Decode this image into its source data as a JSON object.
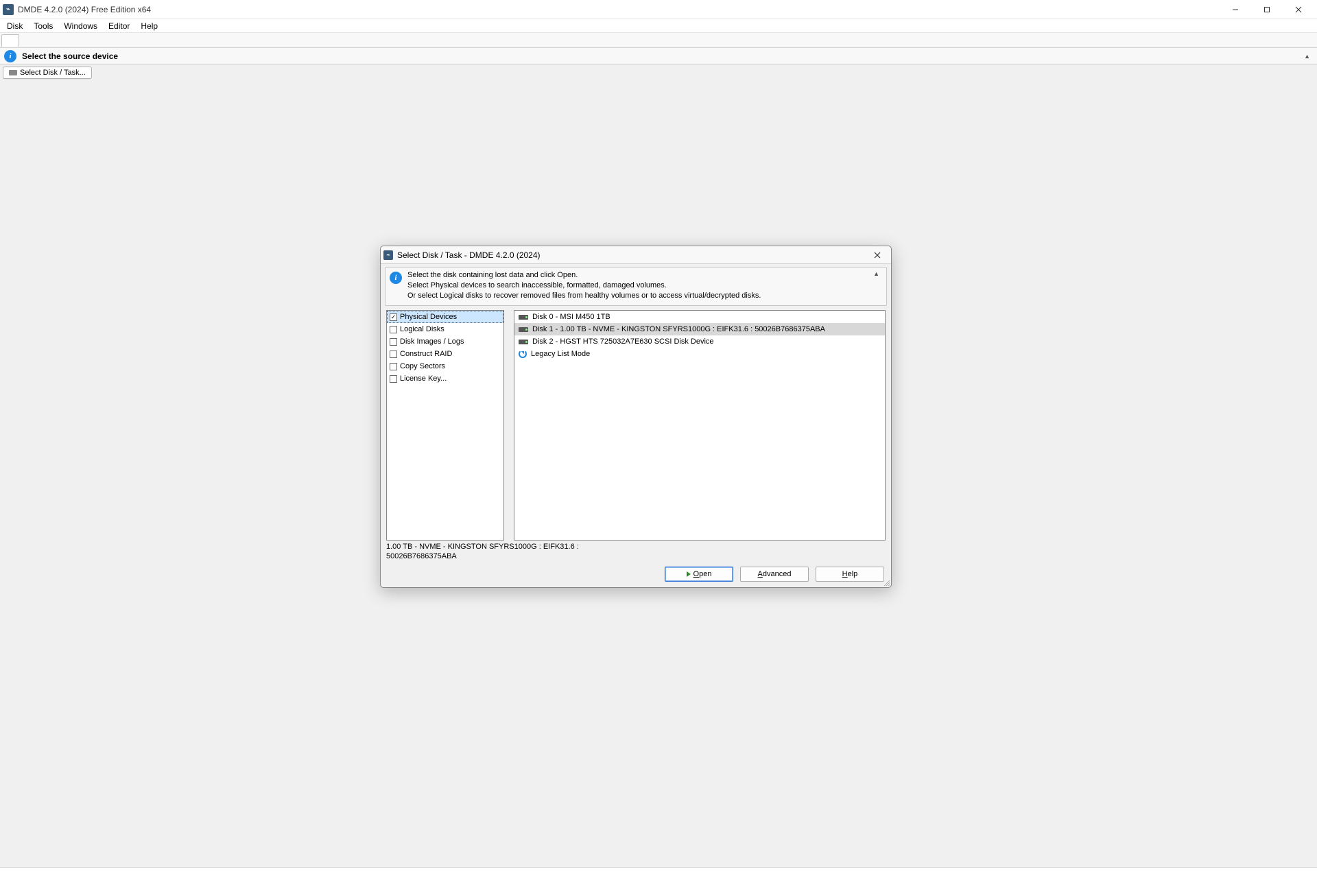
{
  "window": {
    "title": "DMDE 4.2.0 (2024) Free Edition x64"
  },
  "menu": {
    "items": [
      "Disk",
      "Tools",
      "Windows",
      "Editor",
      "Help"
    ]
  },
  "banner": {
    "text": "Select the source device"
  },
  "tab_button": {
    "label": "Select Disk / Task..."
  },
  "dialog": {
    "title": "Select Disk / Task - DMDE 4.2.0 (2024)",
    "info_line1": "Select the disk containing lost data and click Open.",
    "info_line2": "Select Physical devices to search inaccessible, formatted, damaged volumes.",
    "info_line3": "Or select Logical disks to recover removed files from healthy volumes or to access virtual/decrypted disks.",
    "tasks": [
      {
        "label": "Physical Devices",
        "checked": true,
        "selected": true
      },
      {
        "label": "Logical Disks",
        "checked": false,
        "selected": false
      },
      {
        "label": "Disk Images / Logs",
        "checked": false,
        "selected": false
      },
      {
        "label": "Construct RAID",
        "checked": false,
        "selected": false
      },
      {
        "label": "Copy Sectors",
        "checked": false,
        "selected": false
      },
      {
        "label": "License Key...",
        "checked": false,
        "selected": false
      }
    ],
    "devices": [
      {
        "label": "Disk 0 - MSI M450 1TB",
        "icon": "drive",
        "selected": false
      },
      {
        "label": "Disk 1 - 1.00 TB - NVME - KINGSTON SFYRS1000G : EIFK31.6 : 50026B7686375ABA",
        "icon": "drive",
        "selected": true
      },
      {
        "label": "Disk 2 - HGST HTS 725032A7E630 SCSI Disk Device",
        "icon": "drive",
        "selected": false
      },
      {
        "label": "Legacy List Mode",
        "icon": "refresh",
        "selected": false
      }
    ],
    "status_line1": "1.00 TB - NVME - KINGSTON SFYRS1000G : EIFK31.6 :",
    "status_line2": "50026B7686375ABA",
    "buttons": {
      "open": "Open",
      "advanced": "Advanced",
      "help": "Help"
    }
  }
}
